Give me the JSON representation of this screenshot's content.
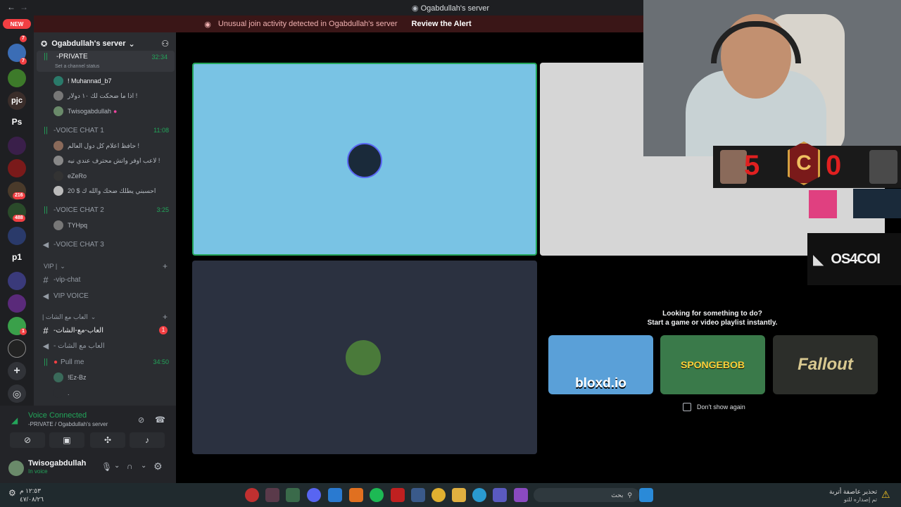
{
  "window": {
    "title": "Ogabdullah's server"
  },
  "alert": {
    "text": "Unusual join activity detected in Ogabdullah's server",
    "action": "Review the Alert"
  },
  "server_rail": {
    "new_label": "NEW",
    "badges": [
      "7",
      "7",
      "216",
      "488",
      "1"
    ],
    "letter_icons": [
      "pjc",
      "Ps",
      "p1"
    ]
  },
  "server": {
    "name": "Ogabdullah's server"
  },
  "channels": {
    "private": {
      "name": "-PRIVATE",
      "time": "32:34",
      "status": "Set a channel status",
      "members": [
        "! Muhannad_b7",
        "اذا ما ضحكت لك ١٠ دولار !",
        "Twisogabdullah"
      ]
    },
    "vc1": {
      "name": "-VOICE CHAT 1",
      "time": "11:08",
      "members": [
        "حافظ اعلام كل دول العالم !",
        "لاعب اوفر واتش محترف عندي نيه !",
        "eZeRo",
        "20 $ احسبني يطلك ضحك والله ك"
      ]
    },
    "vc2": {
      "name": "-VOICE CHAT 2",
      "time": "3:25",
      "members": [
        "TYHpq"
      ]
    },
    "vc3": {
      "name": "-VOICE CHAT 3"
    },
    "vip_cat": "VIP |",
    "vip_chat": "-vip-chat",
    "vip_voice": "VIP VOICE",
    "games_cat": "| العاب مع الشات",
    "games_text": "-العاب-مع-الشات",
    "games_text_badge": "1",
    "games_voice": "- العاب مع الشات",
    "pullme": {
      "name": "Pull me",
      "time": "34:50",
      "members": [
        "!Ez-Bz",
        "."
      ]
    }
  },
  "voice": {
    "status": "Voice Connected",
    "location": "-PRIVATE / Ogabdullah's server"
  },
  "user": {
    "name": "Twisogabdullah",
    "status": "In voice"
  },
  "activity": {
    "title": "Looking for something to do?",
    "subtitle": "Start a game or video playlist instantly.",
    "games": [
      "bloxd.io",
      "SPONGEBOB",
      "Fallout"
    ],
    "dont_show": "Don't show again"
  },
  "overlay": {
    "score_left": "5",
    "score_right": "0",
    "badge_letter": "C",
    "brand": "OS4COI"
  },
  "taskbar": {
    "search": "بحث",
    "news_title": "تحذير عاصفة أتربة",
    "news_sub": "تم إصداره للتو",
    "time": "١٢:٥٣ م",
    "date": "٤٧/٠٨/٢٦"
  },
  "colors": {
    "green": "#23a55a",
    "red": "#f23f43",
    "blurple": "#5865f2"
  }
}
